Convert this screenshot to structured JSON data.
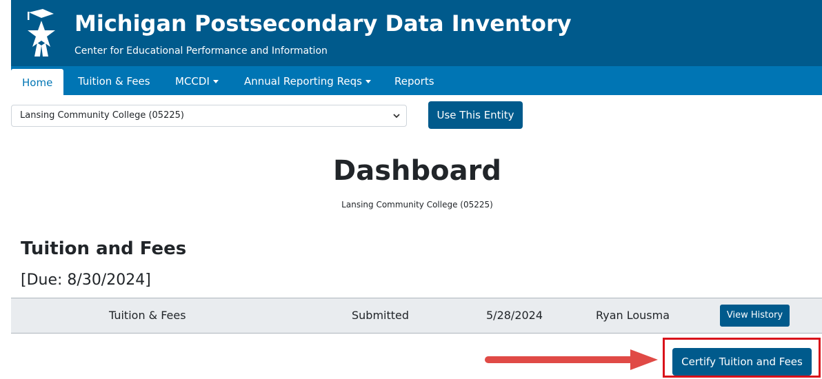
{
  "header": {
    "title": "Michigan Postsecondary Data Inventory",
    "subtitle": "Center for Educational Performance and Information",
    "logo_icon": "michigan-star-graduate-logo",
    "background_color": "#005a8c"
  },
  "nav": {
    "background_color": "#0075b4",
    "items": [
      {
        "label": "Home",
        "active": true
      },
      {
        "label": "Tuition & Fees"
      },
      {
        "label": "MCCDI",
        "dropdown": true
      },
      {
        "label": "Annual Reporting Reqs",
        "dropdown": true
      },
      {
        "label": "Reports"
      }
    ]
  },
  "entity_selector": {
    "selected": "Lansing Community College (05225)",
    "button_label": "Use This Entity"
  },
  "dashboard": {
    "title": "Dashboard",
    "entity": "Lansing Community College (05225)"
  },
  "tuition_section": {
    "title": "Tuition and Fees",
    "due": "[Due: 8/30/2024]",
    "row": {
      "name": "Tuition & Fees",
      "status": "Submitted",
      "date": "5/28/2024",
      "user": "Ryan Lousma",
      "action_label": "View History"
    },
    "certify_label": "Certify Tuition and Fees"
  },
  "annotation": {
    "highlight_color": "#d9111a"
  }
}
